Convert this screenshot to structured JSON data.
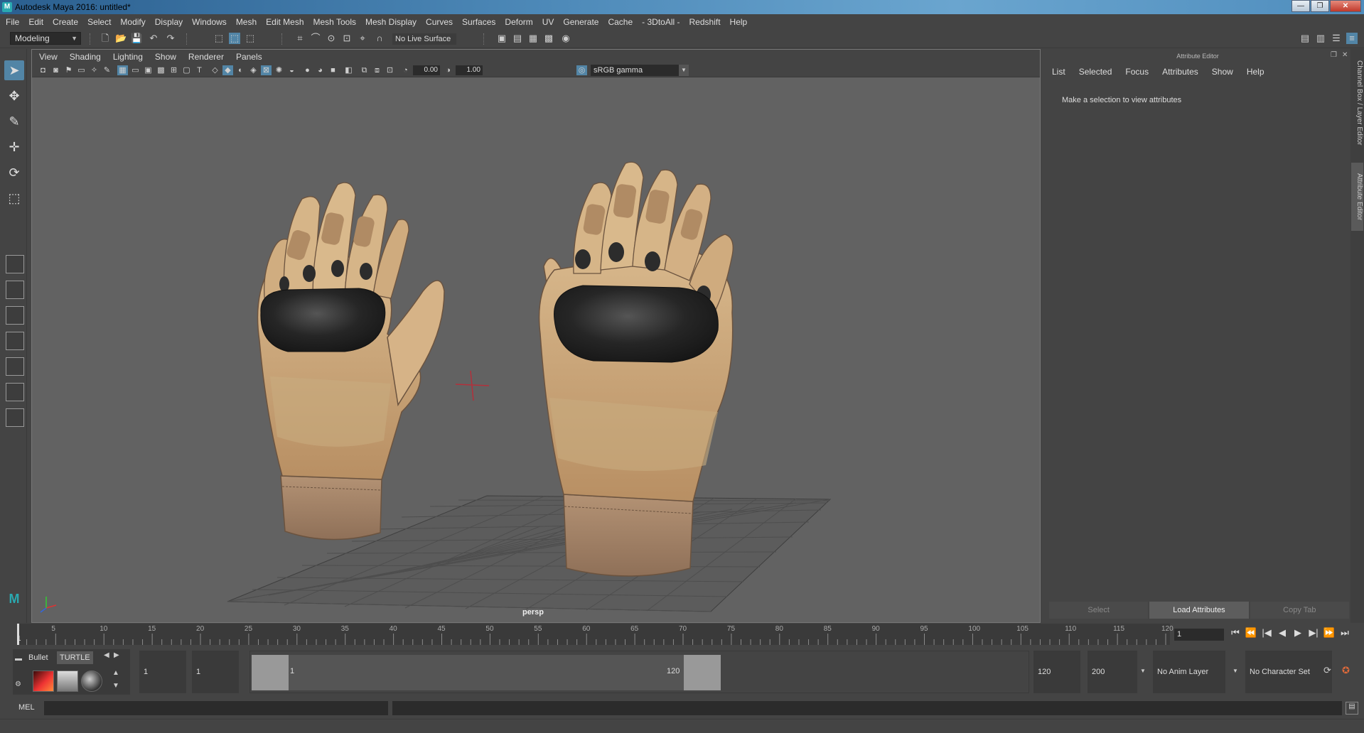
{
  "window": {
    "title": "Autodesk Maya 2016: untitled*",
    "controls": [
      "—",
      "❐",
      "✕"
    ]
  },
  "menubar": [
    "File",
    "Edit",
    "Create",
    "Select",
    "Modify",
    "Display",
    "Windows",
    "Mesh",
    "Edit Mesh",
    "Mesh Tools",
    "Mesh Display",
    "Curves",
    "Surfaces",
    "Deform",
    "UV",
    "Generate",
    "Cache",
    "- 3DtoAll -",
    "Redshift",
    "Help"
  ],
  "statusline": {
    "mode": "Modeling",
    "live_surface": "No Live Surface"
  },
  "viewport": {
    "menu": [
      "View",
      "Shading",
      "Lighting",
      "Show",
      "Renderer",
      "Panels"
    ],
    "exposure": "0.00",
    "gamma_value": "1.00",
    "color_space": "sRGB gamma",
    "camera": "persp"
  },
  "attribute_editor": {
    "title": "Attribute Editor",
    "menu": [
      "List",
      "Selected",
      "Focus",
      "Attributes",
      "Show",
      "Help"
    ],
    "message": "Make a selection to view attributes",
    "buttons": [
      "Select",
      "Load Attributes",
      "Copy Tab"
    ]
  },
  "side_tabs": [
    "Channel Box / Layer Editor",
    "Attribute Editor"
  ],
  "time_slider": {
    "ticks": [
      "5",
      "10",
      "15",
      "20",
      "25",
      "30",
      "35",
      "40",
      "45",
      "50",
      "55",
      "60",
      "65",
      "70",
      "75",
      "80",
      "85",
      "90",
      "95",
      "100",
      "105",
      "110",
      "115",
      "120"
    ],
    "start_label": "1",
    "current_frame": "1",
    "playback": [
      "⏮",
      "⏭|",
      "|◀",
      "◀",
      "▶",
      "▶|",
      "⏭",
      "⏩"
    ]
  },
  "range_slider": {
    "shelf_tabs": [
      "Bullet",
      "TURTLE"
    ],
    "start_time": "1",
    "playback_start": "1",
    "range_start_label": "1",
    "range_end_label": "120",
    "playback_end": "120",
    "end_time": "200",
    "anim_layer": "No Anim Layer",
    "character_set": "No Character Set"
  },
  "command_line": {
    "label": "MEL"
  },
  "colors": {
    "viewport_bg": "#626262",
    "accent": "#5285a6",
    "glove_tan": "#c9a57a",
    "glove_dark": "#2a2a2a"
  }
}
